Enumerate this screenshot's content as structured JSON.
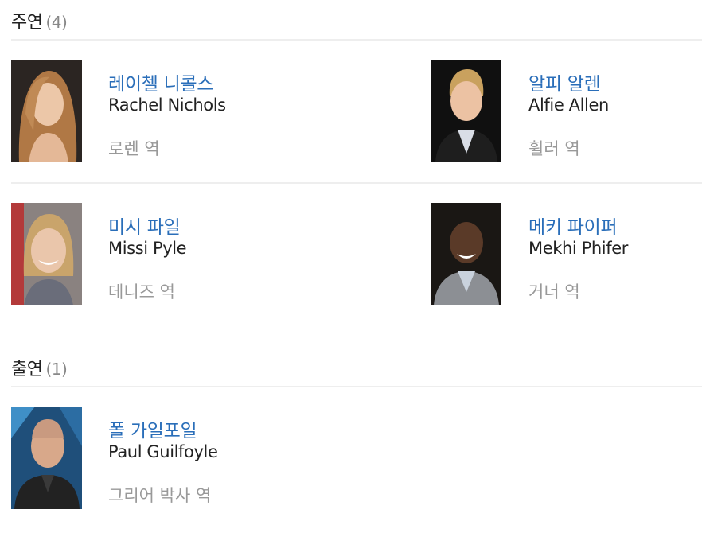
{
  "sections": {
    "main": {
      "title": "주연",
      "count": "(4)"
    },
    "supporting": {
      "title": "출연",
      "count": "(1)"
    }
  },
  "cast": [
    {
      "name_ko": "레이첼 니콜스",
      "name_en": "Rachel Nichols",
      "role": "로렌 역"
    },
    {
      "name_ko": "알피 알렌",
      "name_en": "Alfie Allen",
      "role": "휠러 역"
    },
    {
      "name_ko": "미시 파일",
      "name_en": "Missi Pyle",
      "role": "데니즈 역"
    },
    {
      "name_ko": "메키 파이퍼",
      "name_en": "Mekhi Phifer",
      "role": "거너 역"
    },
    {
      "name_ko": "폴 가일포일",
      "name_en": "Paul Guilfoyle",
      "role": "그리어 박사 역"
    }
  ],
  "colors": {
    "link": "#2a6eb9",
    "text": "#222222",
    "muted": "#999999",
    "divider": "#eeeeee"
  },
  "icons": {
    "portrait": "person-photo"
  }
}
